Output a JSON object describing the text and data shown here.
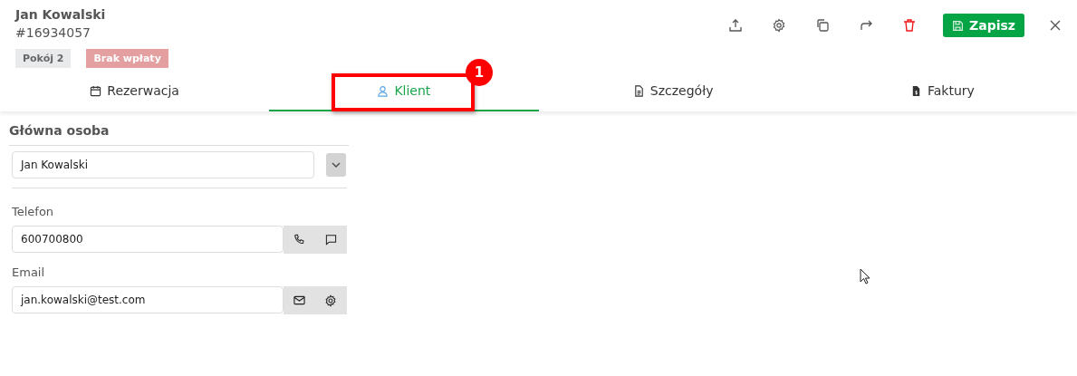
{
  "header": {
    "name": "Jan Kowalski",
    "number": "#16934057",
    "badges": [
      {
        "label": "Pokój 2",
        "kind": "neutral"
      },
      {
        "label": "Brak wpłaty",
        "kind": "warning"
      }
    ],
    "save_button": "Zapisz"
  },
  "tabs": [
    {
      "label": "Rezerwacja",
      "kind": "calendar",
      "selected": false
    },
    {
      "label": "Klient",
      "kind": "person",
      "selected": true
    },
    {
      "label": "Szczegóły",
      "kind": "document",
      "selected": false
    },
    {
      "label": "Faktury",
      "kind": "invoice",
      "selected": false
    }
  ],
  "annotation": {
    "label": "1"
  },
  "main_person": {
    "heading": "Główna osoba",
    "value": "Jan Kowalski"
  },
  "fields": [
    {
      "label": "Telefon",
      "value": "600700800",
      "kind": "phone"
    },
    {
      "label": "Email",
      "value": "jan.kowalski@test.com",
      "kind": "email"
    }
  ]
}
